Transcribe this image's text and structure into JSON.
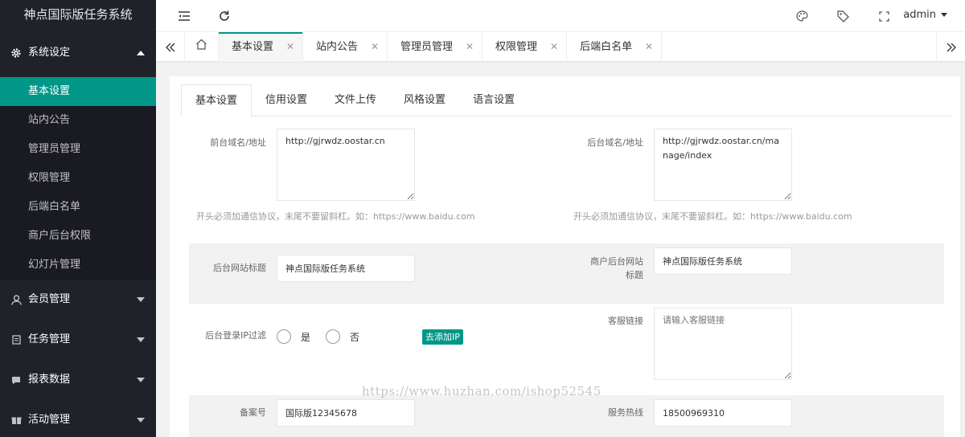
{
  "app": {
    "title": "神点国际版任务系统",
    "user": "admin"
  },
  "accent": "#009688",
  "sidebar": {
    "groups": [
      {
        "label": "系统设定",
        "icon": "gear-icon"
      },
      {
        "label": "会员管理",
        "icon": "user-icon"
      },
      {
        "label": "任务管理",
        "icon": "file-icon"
      },
      {
        "label": "报表数据",
        "icon": "chat-icon"
      },
      {
        "label": "活动管理",
        "icon": "gift-icon"
      }
    ],
    "items": [
      "基本设置",
      "站内公告",
      "管理员管理",
      "权限管理",
      "后端白名单",
      "商户后台权限",
      "幻灯片管理"
    ]
  },
  "pagetabs": [
    "基本设置",
    "站内公告",
    "管理员管理",
    "权限管理",
    "后端白名单"
  ],
  "tabs": [
    "基本设置",
    "信用设置",
    "文件上传",
    "风格设置",
    "语言设置"
  ],
  "form": {
    "front_domain_label": "前台域名/地址",
    "front_domain_value": "http://gjrwdz.oostar.cn",
    "back_domain_label": "后台域名/地址",
    "back_domain_value": "http://gjrwdz.oostar.cn/manage/index",
    "hint": "开头必须加通信协议，末尾不要留斜杠。如：https://www.baidu.com",
    "admin_title_label": "后台网站标题",
    "admin_title_value": "神点国际版任务系统",
    "merchant_title_label": "商户后台网站标题",
    "merchant_title_value": "神点国际版任务系统",
    "ip_filter_label": "后台登录IP过滤",
    "ip_yes": "是",
    "ip_no": "否",
    "add_ip_button": "去添加IP",
    "service_link_label": "客服链接",
    "service_link_placeholder": "请输入客服链接",
    "record_label": "备案号",
    "record_value": "国际版12345678",
    "hotline_label": "服务热线",
    "hotline_value": "18500969310"
  },
  "watermark": "https://www.huzhan.com/ishop52545"
}
